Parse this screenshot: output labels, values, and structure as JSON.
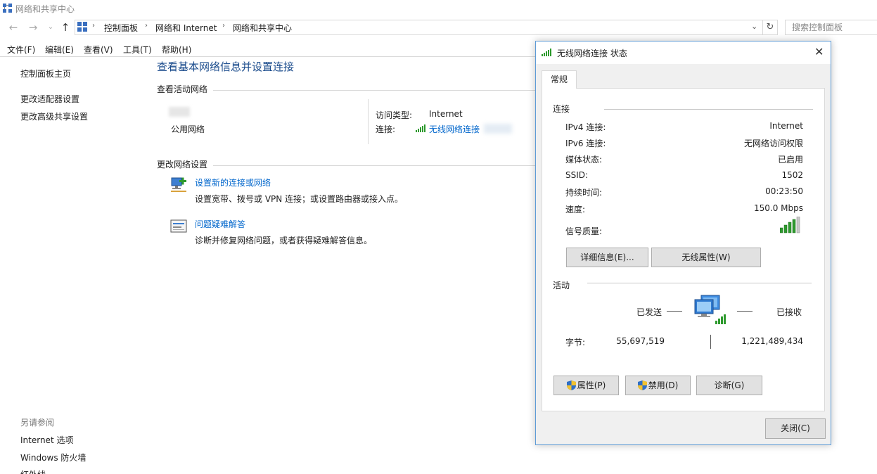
{
  "window": {
    "title": "网络和共享中心"
  },
  "address": {
    "crumbs": [
      "控制面板",
      "网络和 Internet",
      "网络和共享中心"
    ],
    "search_placeholder": "搜索控制面板"
  },
  "menu": [
    "文件(F)",
    "编辑(E)",
    "查看(V)",
    "工具(T)",
    "帮助(H)"
  ],
  "sidebar": {
    "items": [
      "控制面板主页",
      "更改适配器设置",
      "更改高级共享设置"
    ],
    "see_also_title": "另请参阅",
    "see_also": [
      "Internet 选项",
      "Windows 防火墙",
      "红外线"
    ]
  },
  "main": {
    "title": "查看基本网络信息并设置连接",
    "active_networks_title": "查看活动网络",
    "network_type": "公用网络",
    "access_type_label": "访问类型:",
    "access_type_value": "Internet",
    "connection_label": "连接:",
    "connection_value": "无线网络连接",
    "change_settings_title": "更改网络设置",
    "tasks": [
      {
        "title": "设置新的连接或网络",
        "desc": "设置宽带、拨号或 VPN 连接；或设置路由器或接入点。"
      },
      {
        "title": "问题疑难解答",
        "desc": "诊断并修复网络问题，或者获得疑难解答信息。"
      }
    ]
  },
  "dialog": {
    "title": "无线网络连接 状态",
    "tab": "常规",
    "connection_section": "连接",
    "rows": [
      {
        "label": "IPv4 连接:",
        "value": "Internet"
      },
      {
        "label": "IPv6 连接:",
        "value": "无网络访问权限"
      },
      {
        "label": "媒体状态:",
        "value": "已启用"
      },
      {
        "label": "SSID:",
        "value": "1502"
      },
      {
        "label": "持续时间:",
        "value": "00:23:50"
      },
      {
        "label": "速度:",
        "value": "150.0 Mbps"
      }
    ],
    "signal_label": "信号质量:",
    "details_button": "详细信息(E)...",
    "wireless_props_button": "无线属性(W)",
    "activity_section": "活动",
    "sent_label": "已发送",
    "received_label": "已接收",
    "bytes_label": "字节:",
    "bytes_sent": "55,697,519",
    "bytes_received": "1,221,489,434",
    "properties_button": "属性(P)",
    "disable_button": "禁用(D)",
    "diagnose_button": "诊断(G)",
    "close_button": "关闭(C)"
  },
  "colors": {
    "link": "#0066cc",
    "title_blue": "#1a4b8c",
    "signal_green": "#2e9a2e",
    "dialog_border": "#5e9bd6"
  },
  "icons": [
    "network-center-icon",
    "back-arrow-icon",
    "forward-arrow-icon",
    "up-arrow-icon",
    "refresh-icon",
    "signal-bars-icon",
    "computer-network-icon",
    "shield-icon",
    "close-icon"
  ]
}
